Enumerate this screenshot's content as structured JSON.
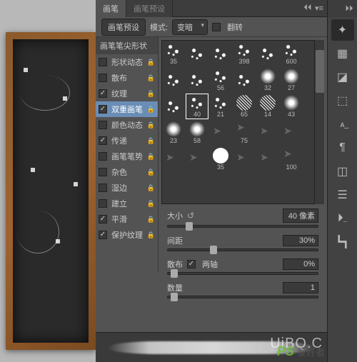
{
  "panel": {
    "tabs": [
      {
        "label": "画笔",
        "active": true
      },
      {
        "label": "画笔预设",
        "active": false
      }
    ],
    "preset_button": "画笔预设",
    "mode_label": "模式:",
    "mode_value": "变暗",
    "flip_label": "翻转"
  },
  "options": {
    "header": "画笔笔尖形状",
    "items": [
      {
        "label": "形状动态",
        "checked": false,
        "locked": true
      },
      {
        "label": "散布",
        "checked": false,
        "locked": true
      },
      {
        "label": "纹理",
        "checked": true,
        "locked": true
      },
      {
        "label": "双重画笔",
        "checked": true,
        "locked": true,
        "selected": true
      },
      {
        "label": "颜色动态",
        "checked": false,
        "locked": true
      },
      {
        "label": "传递",
        "checked": true,
        "locked": true
      },
      {
        "label": "画笔笔势",
        "checked": false,
        "locked": true
      },
      {
        "label": "杂色",
        "checked": false,
        "locked": true
      },
      {
        "label": "湿边",
        "checked": false,
        "locked": true
      },
      {
        "label": "建立",
        "checked": false,
        "locked": true
      },
      {
        "label": "平滑",
        "checked": true,
        "locked": true
      },
      {
        "label": "保护纹理",
        "checked": true,
        "locked": true
      }
    ]
  },
  "brushes": [
    {
      "size": "35",
      "type": "scatter"
    },
    {
      "size": "",
      "type": "scatter"
    },
    {
      "size": "",
      "type": "scatter"
    },
    {
      "size": "398",
      "type": "scatter"
    },
    {
      "size": "",
      "type": "scatter"
    },
    {
      "size": "600",
      "type": "scatter"
    },
    {
      "size": "",
      "type": "scatter"
    },
    {
      "size": "",
      "type": "scatter"
    },
    {
      "size": "56",
      "type": "scatter"
    },
    {
      "size": "",
      "type": "scatter"
    },
    {
      "size": "32",
      "type": "soft"
    },
    {
      "size": "27",
      "type": "soft"
    },
    {
      "size": "",
      "type": "scatter"
    },
    {
      "size": "40",
      "type": "scatter",
      "sel": true
    },
    {
      "size": "21",
      "type": "scatter"
    },
    {
      "size": "65",
      "type": "hatch"
    },
    {
      "size": "14",
      "type": "hatch"
    },
    {
      "size": "43",
      "type": "soft"
    },
    {
      "size": "23",
      "type": "soft"
    },
    {
      "size": "58",
      "type": "soft"
    },
    {
      "size": "",
      "type": "arrow"
    },
    {
      "size": "75",
      "type": "arrow"
    },
    {
      "size": "",
      "type": "arrow"
    },
    {
      "size": "",
      "type": "arrow"
    },
    {
      "size": "",
      "type": "arrow"
    },
    {
      "size": "",
      "type": "arrow"
    },
    {
      "size": "35",
      "type": "solid"
    },
    {
      "size": "",
      "type": "arrow"
    },
    {
      "size": "",
      "type": "arrow"
    },
    {
      "size": "100",
      "type": "arrow"
    }
  ],
  "sliders": {
    "size": {
      "label": "大小",
      "value": "40 像素",
      "pos": 12
    },
    "spacing": {
      "label": "间距",
      "value": "30%",
      "pos": 28
    },
    "scatter": {
      "label": "散布",
      "both_label": "两轴",
      "both_checked": true,
      "value": "0%",
      "pos": 2
    },
    "count": {
      "label": "数量",
      "value": "1",
      "pos": 2
    }
  },
  "watermark": {
    "logo": "PS",
    "cn": "爱好者",
    "url": "UiBQ.C"
  }
}
